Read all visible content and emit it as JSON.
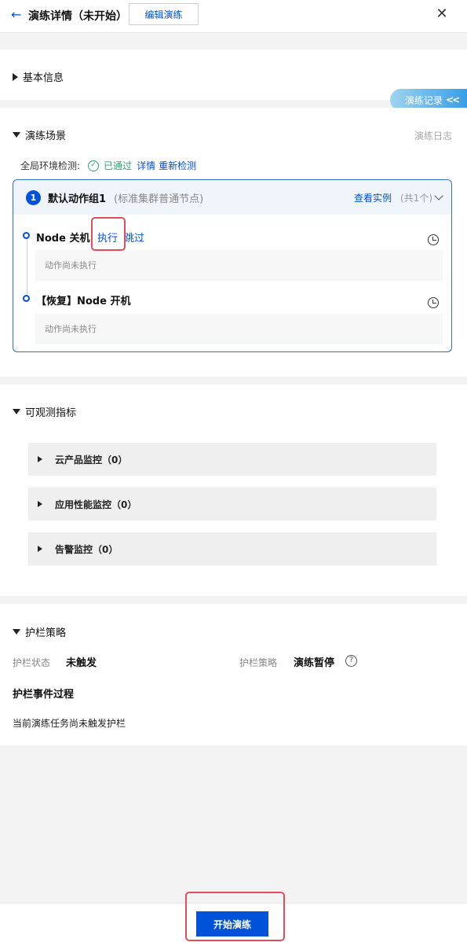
{
  "header": {
    "title": "演练详情（未开始）",
    "edit_button": "编辑演练"
  },
  "drill_log_tab": {
    "label": "演练记录",
    "icon": "double-chevron-left-icon"
  },
  "sections": {
    "basic_info": {
      "title": "基本信息",
      "expanded": false
    },
    "scene": {
      "title": "演练场景",
      "log_link": "演练日志",
      "env_check": {
        "label": "全局环境检测:",
        "status": "已通过",
        "detail_link": "详情",
        "recheck_link": "重新检测"
      },
      "group": {
        "index": "1",
        "name": "默认动作组1",
        "subtitle": "(标准集群普通节点)",
        "view_instances": "查看实例",
        "instance_count": "(共1个)",
        "actions": [
          {
            "name": "Node 关机",
            "execute": "执行",
            "skip": "跳过",
            "status": "动作尚未执行"
          },
          {
            "name": "【恢复】Node 开机",
            "status": "动作尚未执行"
          }
        ]
      }
    },
    "metrics": {
      "title": "可观测指标",
      "items": [
        {
          "label": "云产品监控（0）"
        },
        {
          "label": "应用性能监控（0）"
        },
        {
          "label": "告警监控（0）"
        }
      ]
    },
    "guardrail": {
      "title": "护栏策略",
      "state_label": "护栏状态",
      "state_value": "未触发",
      "policy_label": "护栏策略",
      "policy_value": "演练暂停",
      "events_title": "护栏事件过程",
      "events_text": "当前演练任务尚未触发护栏"
    }
  },
  "footer": {
    "start_button": "开始演练"
  },
  "colors": {
    "primary": "#0052d9",
    "success": "#2ba471",
    "highlight": "#e34d59"
  }
}
